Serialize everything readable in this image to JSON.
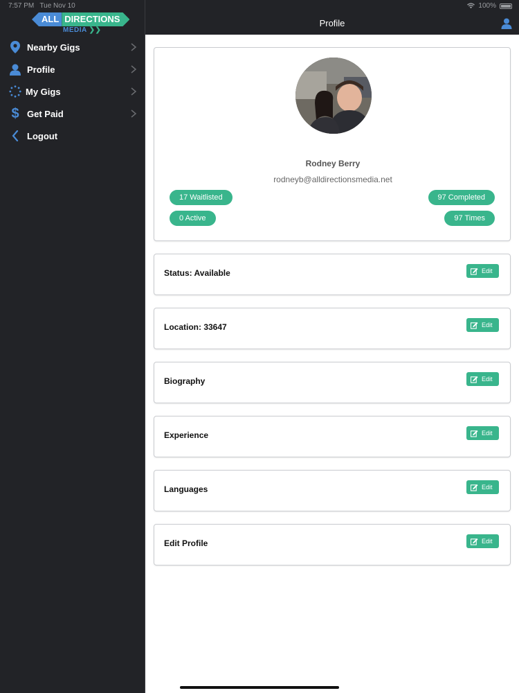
{
  "status_bar": {
    "time": "7:57 PM",
    "date": "Tue Nov 10",
    "battery": "100%"
  },
  "logo": {
    "word1": "ALL",
    "word2": "DIRECTIONS",
    "word3": "MEDIA"
  },
  "sidebar": {
    "items": [
      {
        "label": "Nearby Gigs",
        "icon": "location-pin-icon"
      },
      {
        "label": "Profile",
        "icon": "person-icon"
      },
      {
        "label": "My Gigs",
        "icon": "spinner-icon"
      },
      {
        "label": "Get Paid",
        "icon": "dollar-icon"
      },
      {
        "label": "Logout",
        "icon": "back-chevron-icon"
      }
    ]
  },
  "header": {
    "title": "Profile"
  },
  "profile": {
    "name": "Rodney Berry",
    "email": "rodneyb@alldirectionsmedia.net",
    "stats": {
      "waitlisted": "17 Waitlisted",
      "active": "0 Active",
      "completed": "97 Completed",
      "times": "97 Times"
    }
  },
  "sections": [
    {
      "title": "Status: Available",
      "edit_label": "Edit"
    },
    {
      "title": "Location: 33647",
      "edit_label": "Edit"
    },
    {
      "title": "Biography",
      "edit_label": "Edit"
    },
    {
      "title": "Experience",
      "edit_label": "Edit"
    },
    {
      "title": "Languages",
      "edit_label": "Edit"
    },
    {
      "title": "Edit Profile",
      "edit_label": "Edit"
    }
  ],
  "colors": {
    "accent_green": "#39b58c",
    "accent_blue": "#4a8bd6",
    "sidebar_bg": "#222327"
  }
}
